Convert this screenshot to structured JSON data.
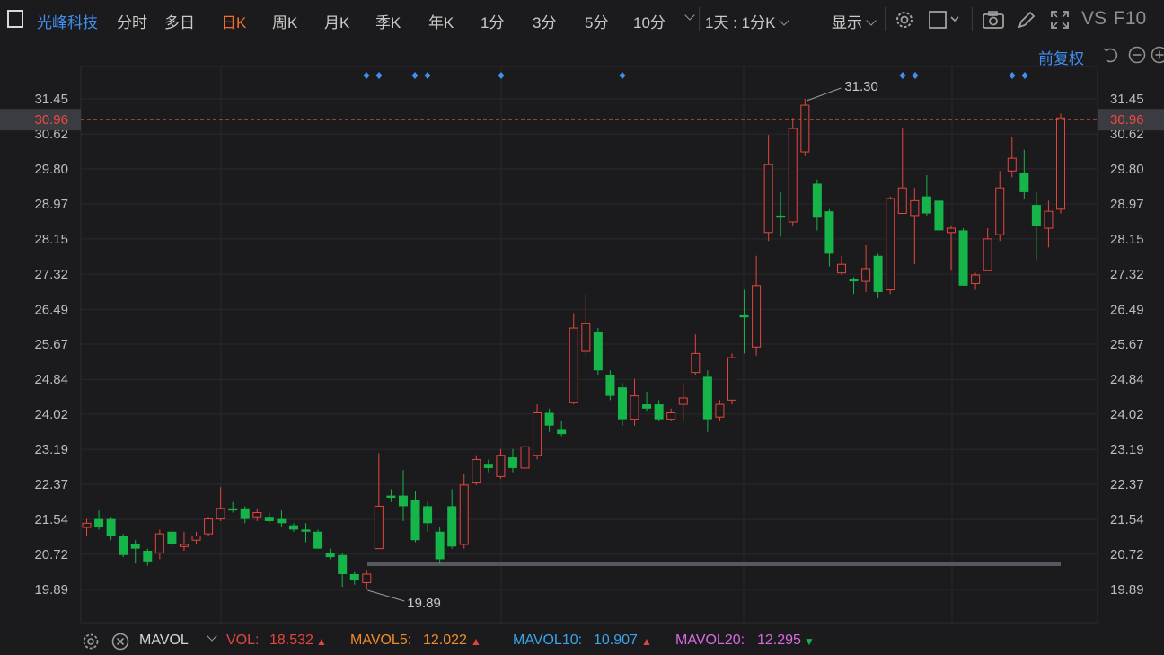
{
  "stock_name": "光峰科技",
  "tabs": [
    {
      "label": "分时",
      "active": false
    },
    {
      "label": "多日",
      "active": false
    },
    {
      "label": "日K",
      "active": true
    },
    {
      "label": "周K",
      "active": false
    },
    {
      "label": "月K",
      "active": false
    },
    {
      "label": "季K",
      "active": false
    },
    {
      "label": "年K",
      "active": false
    },
    {
      "label": "1分",
      "active": false
    },
    {
      "label": "3分",
      "active": false
    },
    {
      "label": "5分",
      "active": false
    },
    {
      "label": "10分",
      "active": false
    }
  ],
  "period_select": "1天 : 1分K",
  "display_label": "显示",
  "vs_label": "VS",
  "f10_label": "F10",
  "adjust_label": "前复权",
  "chart_data": {
    "type": "candlestick",
    "y_ticks": [
      "31.45",
      "30.62",
      "29.80",
      "28.97",
      "28.15",
      "27.32",
      "26.49",
      "25.67",
      "24.84",
      "24.02",
      "23.19",
      "22.37",
      "21.54",
      "20.72",
      "19.89"
    ],
    "ylim": [
      19.89,
      31.45
    ],
    "current_price": "30.96",
    "max_label": "31.30",
    "min_label": "19.89",
    "colors": {
      "up": "#e5453d",
      "down": "#15b54a",
      "current": "#e5533a",
      "marker": "#3f8ff0"
    },
    "candles": [
      [
        21.35,
        21.45,
        21.15,
        21.55
      ],
      [
        21.55,
        21.35,
        21.3,
        21.75
      ],
      [
        21.55,
        21.15,
        21.05,
        21.6
      ],
      [
        21.15,
        20.7,
        20.65,
        21.2
      ],
      [
        20.95,
        20.85,
        20.5,
        21.05
      ],
      [
        20.8,
        20.55,
        20.45,
        20.85
      ],
      [
        20.75,
        21.2,
        20.6,
        21.3
      ],
      [
        21.25,
        20.95,
        20.85,
        21.35
      ],
      [
        20.9,
        20.95,
        20.8,
        21.25
      ],
      [
        21.05,
        21.15,
        20.95,
        21.25
      ],
      [
        21.2,
        21.55,
        21.15,
        21.6
      ],
      [
        21.55,
        21.8,
        21.5,
        22.3
      ],
      [
        21.8,
        21.75,
        21.7,
        21.95
      ],
      [
        21.8,
        21.55,
        21.45,
        21.85
      ],
      [
        21.6,
        21.7,
        21.5,
        21.8
      ],
      [
        21.6,
        21.5,
        21.45,
        21.7
      ],
      [
        21.55,
        21.45,
        21.35,
        21.75
      ],
      [
        21.4,
        21.3,
        21.25,
        21.45
      ],
      [
        21.3,
        21.25,
        21.0,
        21.45
      ],
      [
        21.25,
        20.85,
        20.85,
        21.3
      ],
      [
        20.75,
        20.65,
        20.6,
        20.85
      ],
      [
        20.7,
        20.25,
        19.95,
        20.75
      ],
      [
        20.25,
        20.1,
        20.0,
        20.3
      ],
      [
        20.05,
        20.25,
        19.89,
        20.35
      ],
      [
        20.85,
        21.85,
        20.85,
        23.1
      ],
      [
        22.1,
        22.05,
        21.95,
        22.25
      ],
      [
        22.1,
        21.85,
        21.5,
        22.7
      ],
      [
        22.0,
        21.05,
        21.0,
        22.2
      ],
      [
        21.85,
        21.45,
        21.25,
        21.95
      ],
      [
        21.25,
        20.6,
        20.5,
        21.35
      ],
      [
        21.85,
        20.9,
        20.85,
        22.25
      ],
      [
        20.95,
        22.35,
        20.85,
        22.6
      ],
      [
        22.4,
        22.95,
        22.35,
        23.05
      ],
      [
        22.85,
        22.75,
        22.65,
        22.95
      ],
      [
        22.55,
        23.05,
        22.5,
        23.2
      ],
      [
        23.0,
        22.75,
        22.65,
        23.2
      ],
      [
        22.75,
        23.25,
        22.65,
        23.55
      ],
      [
        23.05,
        24.05,
        22.95,
        24.25
      ],
      [
        24.05,
        23.75,
        23.6,
        24.15
      ],
      [
        23.65,
        23.55,
        23.5,
        23.85
      ],
      [
        24.3,
        26.05,
        24.25,
        26.4
      ],
      [
        25.5,
        26.15,
        25.4,
        26.85
      ],
      [
        25.95,
        25.05,
        24.95,
        26.05
      ],
      [
        24.95,
        24.45,
        24.35,
        25.05
      ],
      [
        24.65,
        23.9,
        23.75,
        24.75
      ],
      [
        23.9,
        24.45,
        23.75,
        24.85
      ],
      [
        24.25,
        24.15,
        24.1,
        24.55
      ],
      [
        24.25,
        23.9,
        23.85,
        24.35
      ],
      [
        23.9,
        24.05,
        23.85,
        24.15
      ],
      [
        24.25,
        24.4,
        23.85,
        24.75
      ],
      [
        25.0,
        25.45,
        24.95,
        25.9
      ],
      [
        24.9,
        23.9,
        23.6,
        25.05
      ],
      [
        23.95,
        24.25,
        23.85,
        24.35
      ],
      [
        24.35,
        25.35,
        24.25,
        25.45
      ],
      [
        26.35,
        26.3,
        25.45,
        26.95
      ],
      [
        25.6,
        27.05,
        25.4,
        27.75
      ],
      [
        28.3,
        29.9,
        28.1,
        30.6
      ],
      [
        28.7,
        28.65,
        28.2,
        29.25
      ],
      [
        28.55,
        30.75,
        28.45,
        31.0
      ],
      [
        30.2,
        31.3,
        30.1,
        31.45
      ],
      [
        29.45,
        28.65,
        28.35,
        29.55
      ],
      [
        28.8,
        27.8,
        27.5,
        28.85
      ],
      [
        27.35,
        27.55,
        27.3,
        27.75
      ],
      [
        27.2,
        27.15,
        26.85,
        27.25
      ],
      [
        27.15,
        27.45,
        26.9,
        28.0
      ],
      [
        27.75,
        26.9,
        26.75,
        27.8
      ],
      [
        26.95,
        29.1,
        26.85,
        29.15
      ],
      [
        28.75,
        29.35,
        28.75,
        30.75
      ],
      [
        28.7,
        29.05,
        27.55,
        29.35
      ],
      [
        29.15,
        28.75,
        28.7,
        29.65
      ],
      [
        29.05,
        28.35,
        28.25,
        29.15
      ],
      [
        28.3,
        28.4,
        27.4,
        28.45
      ],
      [
        28.35,
        27.05,
        27.05,
        28.4
      ],
      [
        27.1,
        27.3,
        26.95,
        27.35
      ],
      [
        27.4,
        28.15,
        27.4,
        28.4
      ],
      [
        28.25,
        29.35,
        28.1,
        29.75
      ],
      [
        29.75,
        30.05,
        29.6,
        30.55
      ],
      [
        29.7,
        29.25,
        29.1,
        30.25
      ],
      [
        28.95,
        28.45,
        27.65,
        29.25
      ],
      [
        28.4,
        28.8,
        27.95,
        29.05
      ],
      [
        28.85,
        31.0,
        28.75,
        31.1
      ]
    ],
    "markers": [
      1,
      2,
      5,
      6,
      9,
      16,
      48,
      49,
      52,
      53
    ]
  },
  "indicator": {
    "name": "MAVOL",
    "vol_label": "VOL:",
    "vol_value": "18.532",
    "mavol5_label": "MAVOL5:",
    "mavol5_value": "12.022",
    "mavol10_label": "MAVOL10:",
    "mavol10_value": "10.907",
    "mavol20_label": "MAVOL20:",
    "mavol20_value": "12.295"
  }
}
